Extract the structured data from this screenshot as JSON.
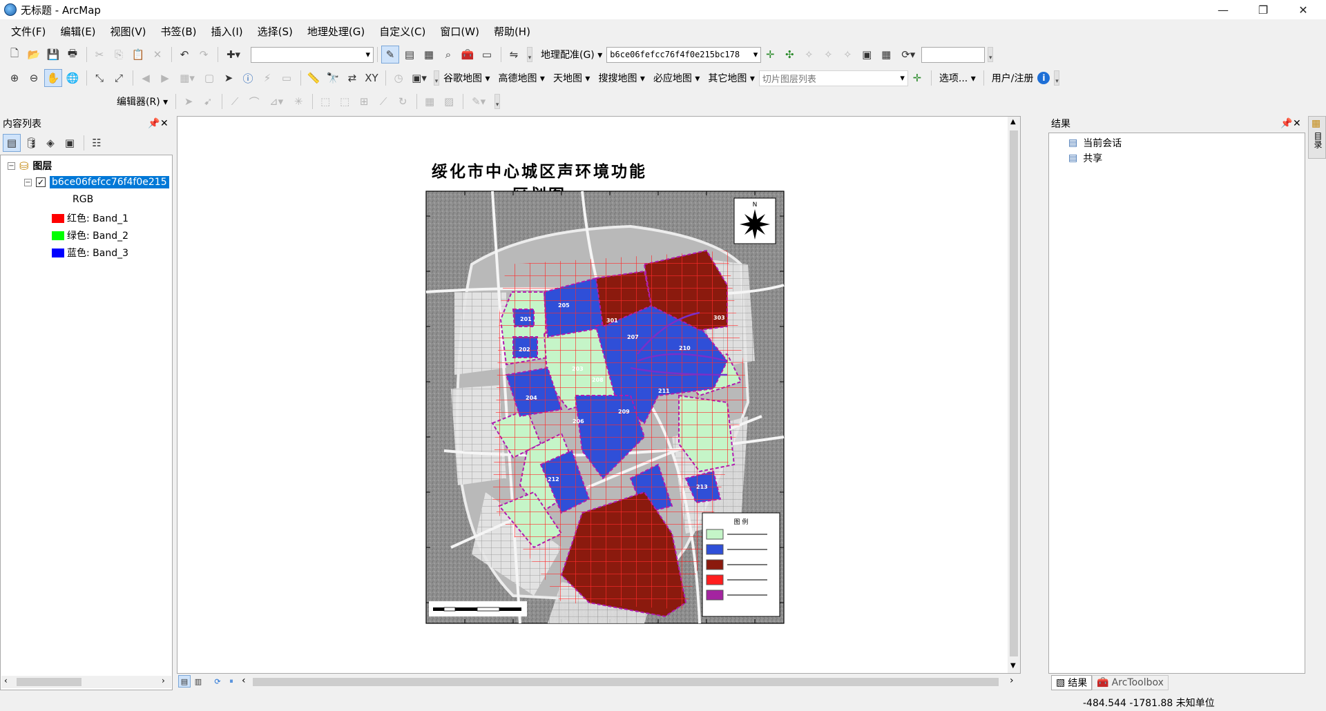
{
  "window": {
    "title": "无标题 - ArcMap",
    "controls": [
      "—",
      "❐",
      "✕"
    ]
  },
  "menubar": {
    "items": [
      "文件(F)",
      "编辑(E)",
      "视图(V)",
      "书签(B)",
      "插入(I)",
      "选择(S)",
      "地理处理(G)",
      "自定义(C)",
      "窗口(W)",
      "帮助(H)"
    ]
  },
  "toolbar1": {
    "scale_value": "",
    "georef_label": "地理配准(G)",
    "georef_layer": "b6ce06fefcc76f4f0e215bc178",
    "extra_input_value": ""
  },
  "toolbar2": {
    "map_menus": [
      "谷歌地图",
      "高德地图",
      "天地图",
      "搜搜地图",
      "必应地图",
      "其它地图"
    ],
    "tile_list_placeholder": "切片图层列表",
    "options_label": "选项...",
    "user_label": "用户/注册"
  },
  "toolbar3": {
    "editor_label": "编辑器(R)"
  },
  "toc": {
    "title": "内容列表",
    "root_label": "图层",
    "layer_name": "b6ce06fefcc76f4f0e215",
    "rgb_label": "RGB",
    "bands": [
      {
        "color": "#ff0000",
        "label": "红色:    Band_1"
      },
      {
        "color": "#00ff00",
        "label": "绿色: Band_2"
      },
      {
        "color": "#0000ff",
        "label": "蓝色:    Band_3"
      }
    ]
  },
  "map": {
    "title": "绥化市中心城区声环境功能区划图",
    "north_label": "N",
    "legend_title": "图 例",
    "zone_labels": [
      "205",
      "301",
      "207",
      "201",
      "202",
      "203",
      "208",
      "211",
      "206",
      "209",
      "204",
      "212",
      "213",
      "210",
      "303"
    ],
    "zone_colors": {
      "class1": "#c5f5c8",
      "class2": "#2f4fd8",
      "class3": "#8b1a0e",
      "class4a": "#ff1e1e",
      "class4b": "#a424a0"
    }
  },
  "results": {
    "title": "结果",
    "items": [
      "当前会话",
      "共享"
    ],
    "tabs": [
      "结果",
      "ArcToolbox"
    ]
  },
  "right_strip": {
    "label": "目录"
  },
  "status": {
    "coordinates": "-484.544  -1781.88 未知单位"
  }
}
